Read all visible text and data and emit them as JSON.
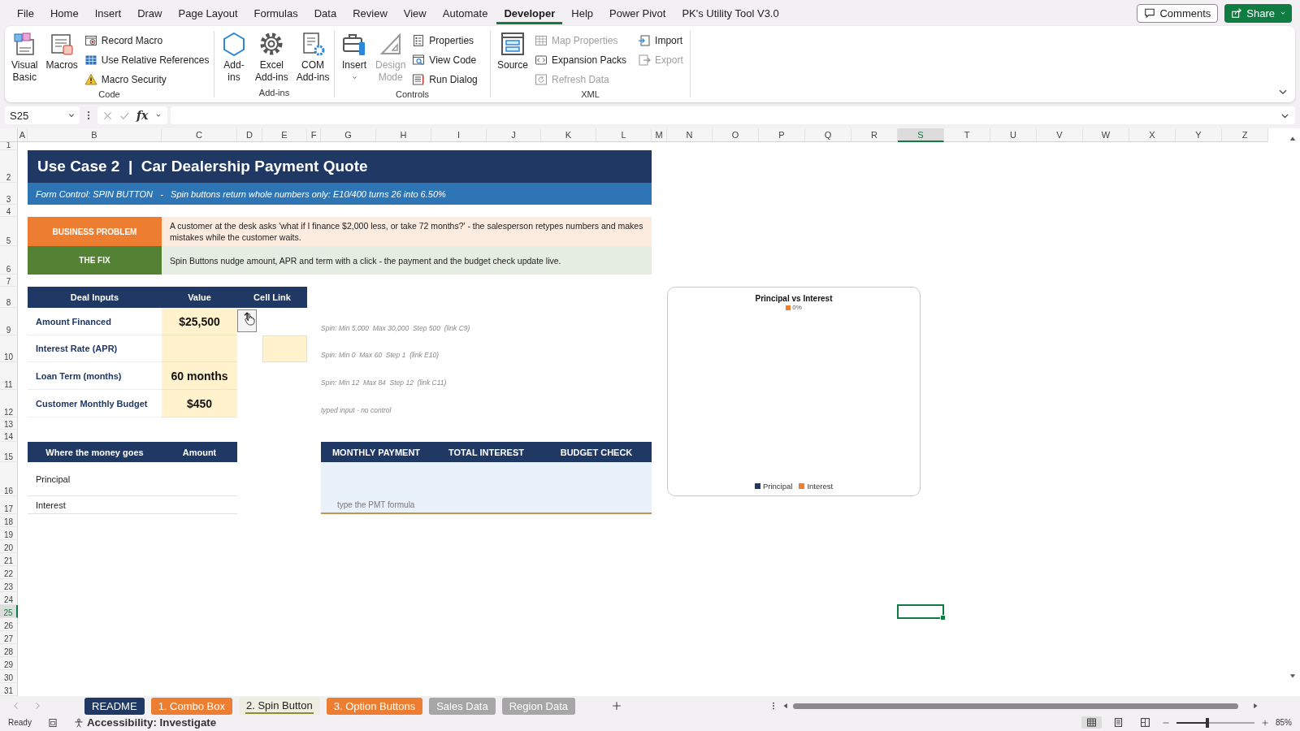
{
  "ribbon_tabs": [
    {
      "label": "File",
      "selected": false
    },
    {
      "label": "Home",
      "selected": false
    },
    {
      "label": "Insert",
      "selected": false
    },
    {
      "label": "Draw",
      "selected": false
    },
    {
      "label": "Page Layout",
      "selected": false
    },
    {
      "label": "Formulas",
      "selected": false
    },
    {
      "label": "Data",
      "selected": false
    },
    {
      "label": "Review",
      "selected": false
    },
    {
      "label": "View",
      "selected": false
    },
    {
      "label": "Automate",
      "selected": false
    },
    {
      "label": "Developer",
      "selected": true
    },
    {
      "label": "Help",
      "selected": false
    },
    {
      "label": "Power Pivot",
      "selected": false
    },
    {
      "label": "PK's Utility Tool V3.0",
      "selected": false
    }
  ],
  "header_buttons": {
    "comments": "Comments",
    "share": "Share"
  },
  "ribbon_groups": [
    {
      "label": "Code",
      "large": [
        {
          "label": "Visual\nBasic",
          "disabled": false
        },
        {
          "label": "Macros",
          "disabled": false
        }
      ],
      "small": [
        {
          "label": "Record Macro",
          "disabled": false
        },
        {
          "label": "Use Relative References",
          "disabled": false
        },
        {
          "label": "Macro Security",
          "disabled": false
        }
      ]
    },
    {
      "label": "Add-ins",
      "large": [
        {
          "label": "Add-\nins",
          "disabled": false
        },
        {
          "label": "Excel\nAdd-ins",
          "disabled": false
        },
        {
          "label": "COM\nAdd-ins",
          "disabled": false
        }
      ]
    },
    {
      "label": "Controls",
      "large": [
        {
          "label": "Insert",
          "disabled": false,
          "dropdown": true
        },
        {
          "label": "Design\nMode",
          "disabled": true
        }
      ],
      "small": [
        {
          "label": "Properties",
          "disabled": false
        },
        {
          "label": "View Code",
          "disabled": false
        },
        {
          "label": "Run Dialog",
          "disabled": false
        }
      ]
    },
    {
      "label": "XML",
      "large": [
        {
          "label": "Source",
          "disabled": false
        }
      ],
      "small": [
        {
          "label": "Map Properties",
          "disabled": true
        },
        {
          "label": "Expansion Packs",
          "disabled": false
        },
        {
          "label": "Refresh Data",
          "disabled": true
        },
        {
          "label": "Import",
          "disabled": false
        },
        {
          "label": "Export",
          "disabled": true
        }
      ]
    }
  ],
  "formula_bar": {
    "name_box": "S25",
    "function_button": "fx"
  },
  "columns": [
    {
      "label": "A",
      "selected": false
    },
    {
      "label": "B",
      "selected": false
    },
    {
      "label": "C",
      "selected": false
    },
    {
      "label": "D",
      "selected": false
    },
    {
      "label": "E",
      "selected": false
    },
    {
      "label": "F",
      "selected": false
    },
    {
      "label": "G",
      "selected": false
    },
    {
      "label": "H",
      "selected": false
    },
    {
      "label": "I",
      "selected": false
    },
    {
      "label": "J",
      "selected": false
    },
    {
      "label": "K",
      "selected": false
    },
    {
      "label": "L",
      "selected": false
    },
    {
      "label": "M",
      "selected": false
    },
    {
      "label": "N",
      "selected": false
    },
    {
      "label": "O",
      "selected": false
    },
    {
      "label": "P",
      "selected": false
    },
    {
      "label": "Q",
      "selected": false
    },
    {
      "label": "R",
      "selected": false
    },
    {
      "label": "S",
      "selected": true
    },
    {
      "label": "T",
      "selected": false
    },
    {
      "label": "U",
      "selected": false
    },
    {
      "label": "V",
      "selected": false
    },
    {
      "label": "W",
      "selected": false
    },
    {
      "label": "X",
      "selected": false
    },
    {
      "label": "Y",
      "selected": false
    },
    {
      "label": "Z",
      "selected": false
    }
  ],
  "row_headers": [
    {
      "label": "1",
      "selected": false
    },
    {
      "label": "2",
      "selected": false
    },
    {
      "label": "3",
      "selected": false
    },
    {
      "label": "4",
      "selected": false
    },
    {
      "label": "5",
      "selected": false
    },
    {
      "label": "6",
      "selected": false
    },
    {
      "label": "7",
      "selected": false
    },
    {
      "label": "8",
      "selected": false
    },
    {
      "label": "9",
      "selected": false
    },
    {
      "label": "10",
      "selected": false
    },
    {
      "label": "11",
      "selected": false
    },
    {
      "label": "12",
      "selected": false
    },
    {
      "label": "13",
      "selected": false
    },
    {
      "label": "14",
      "selected": false
    },
    {
      "label": "15",
      "selected": false
    },
    {
      "label": "16",
      "selected": false
    },
    {
      "label": "17",
      "selected": false
    },
    {
      "label": "18",
      "selected": false
    },
    {
      "label": "19",
      "selected": false
    },
    {
      "label": "20",
      "selected": false
    },
    {
      "label": "21",
      "selected": false
    },
    {
      "label": "22",
      "selected": false
    },
    {
      "label": "23",
      "selected": false
    },
    {
      "label": "24",
      "selected": false
    },
    {
      "label": "25",
      "selected": true
    },
    {
      "label": "26",
      "selected": false
    },
    {
      "label": "27",
      "selected": false
    },
    {
      "label": "28",
      "selected": false
    },
    {
      "label": "29",
      "selected": false
    },
    {
      "label": "30",
      "selected": false
    },
    {
      "label": "31",
      "selected": false
    }
  ],
  "sheet": {
    "title": "Use Case 2  |  Car Dealership Payment Quote",
    "subtitle": "Form Control: SPIN BUTTON   -   Spin buttons return whole numbers only: E10/400 turns 26 into 6.50%",
    "callouts": [
      {
        "label": "BUSINESS PROBLEM",
        "text": "A customer at the desk asks 'what if I finance $2,000 less, or take 72 months?' - the salesperson retypes numbers and makes mistakes while the customer waits.",
        "color": "#ed7d31"
      },
      {
        "label": "THE FIX",
        "text": "Spin Buttons nudge amount, APR and term with a click - the payment and the budget check update live.",
        "color": "#548235"
      }
    ],
    "deal_inputs": {
      "columns": [
        "Deal Inputs",
        "Value",
        "Cell Link"
      ],
      "rows": [
        {
          "label": "Amount Financed",
          "value": "$25,500",
          "spin_button": true,
          "note": "Spin: Min 5,000  Max 30,000  Step 500  (link C9)"
        },
        {
          "label": "Interest Rate (APR)",
          "linked_cell": true,
          "note": "Spin: Min 0  Max 60  Step 1  (link E10)"
        },
        {
          "label": "Loan Term (months)",
          "value": "60 months",
          "note": "Spin: Min 12  Max 84  Step 12  (link C11)"
        },
        {
          "label": "Customer Monthly Budget",
          "value": "$450",
          "note": "typed input - no control"
        }
      ]
    },
    "money_table": {
      "columns": [
        "Where the money goes",
        "Amount"
      ],
      "rows": [
        "Principal",
        "Interest"
      ]
    },
    "summary": {
      "columns": [
        "MONTHLY PAYMENT",
        "TOTAL INTEREST",
        "BUDGET CHECK"
      ],
      "hint": "type the PMT formula"
    },
    "chart": {
      "title": "Principal vs Interest",
      "data_label": "0%",
      "legend": [
        {
          "label": "Principal",
          "color": "#1f3864"
        },
        {
          "label": "Interest",
          "color": "#ed7d31"
        }
      ]
    }
  },
  "sheet_tabs": [
    {
      "label": "README",
      "color": "#1f3864",
      "selected": false
    },
    {
      "label": "1. Combo Box",
      "color": "#ed7d31",
      "selected": false
    },
    {
      "label": "2. Spin Button",
      "color": "#8a8f2c",
      "selected": true
    },
    {
      "label": "3. Option Buttons",
      "color": "#ed7d31",
      "selected": false
    },
    {
      "label": "Sales Data",
      "color": "#a6a6a6",
      "selected": false
    },
    {
      "label": "Region Data",
      "color": "#a6a6a6",
      "selected": false
    }
  ],
  "status_bar": {
    "status": "Ready",
    "accessibility": "Accessibility: Investigate",
    "views": [
      {
        "selected": true
      },
      {
        "selected": false
      },
      {
        "selected": false
      }
    ],
    "zoom_slider": {
      "level": 0.42
    },
    "zoom": "85%"
  }
}
